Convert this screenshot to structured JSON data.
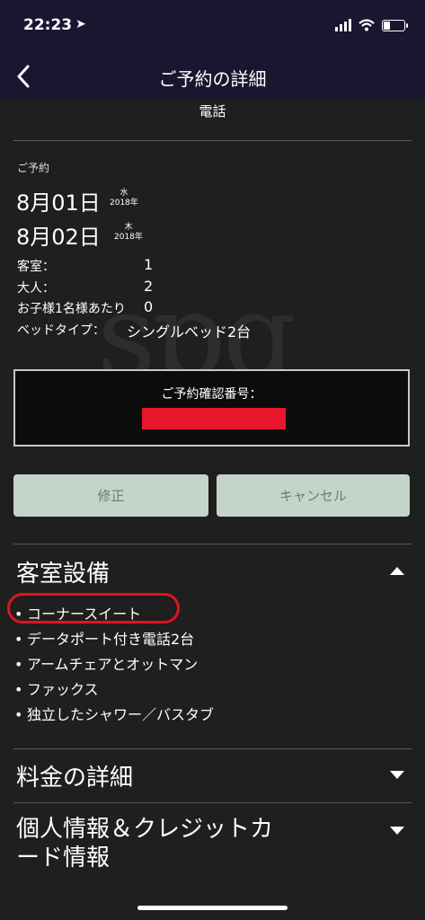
{
  "status_bar": {
    "time": "22:23",
    "location_icon": "location-arrow-icon",
    "signal_icon": "cellular-signal-icon",
    "wifi_icon": "wifi-icon",
    "battery_icon": "battery-icon",
    "battery_level": 0.3
  },
  "nav": {
    "title": "ご予約の詳細",
    "back_icon": "chevron-left-icon"
  },
  "phone_label": "電話",
  "watermark": "spg",
  "reservation": {
    "section_label": "ご予約",
    "checkin": {
      "date": "8月01日",
      "dow": "水",
      "year": "2018年"
    },
    "checkout": {
      "date": "8月02日",
      "dow": "木",
      "year": "2018年"
    },
    "rooms_label": "客室：",
    "rooms_value": "1",
    "adults_label": "大人：",
    "adults_value": "2",
    "children_label": "お子様1名様あたり",
    "children_value": "0",
    "bed_label": "ベッドタイプ：",
    "bed_value": "シングルベッド2台"
  },
  "confirmation": {
    "label": "ご予約確認番号："
  },
  "buttons": {
    "modify": "修正",
    "cancel": "キャンセル"
  },
  "room_amenities": {
    "title": "客室設備",
    "items": [
      "コーナースイート",
      "データポート付き電話2台",
      "アームチェアとオットマン",
      "ファックス",
      "独立したシャワー／バスタブ"
    ]
  },
  "rate_details": {
    "title": "料金の詳細"
  },
  "personal_info": {
    "title_line1": "個人情報＆クレジットカ",
    "title_line2": "ード情報"
  },
  "colors": {
    "background": "#1f1f1f",
    "header": "#1c1530",
    "button": "#c5d4c9",
    "highlight_circle": "#e0141f",
    "redaction": "#e8162b"
  }
}
